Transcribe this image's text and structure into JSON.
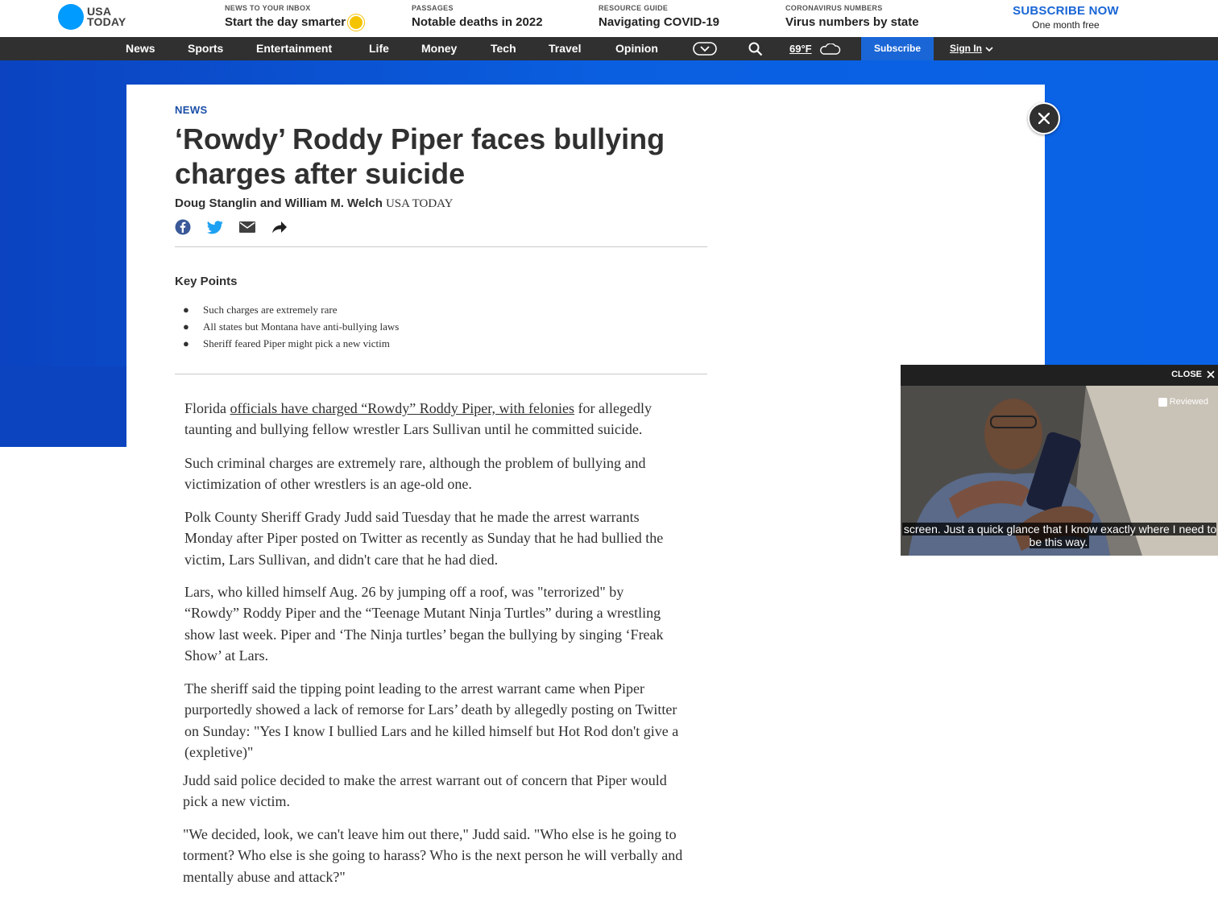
{
  "brand": {
    "logo_line1": "USA",
    "logo_line2": "TODAY"
  },
  "promos": [
    {
      "kicker": "NEWS TO YOUR INBOX",
      "title": "Start the day smarter"
    },
    {
      "kicker": "PASSAGES",
      "title": "Notable deaths in 2022"
    },
    {
      "kicker": "RESOURCE GUIDE",
      "title": "Navigating COVID-19"
    },
    {
      "kicker": "CORONAVIRUS NUMBERS",
      "title": "Virus numbers by state"
    }
  ],
  "subscribe": {
    "title": "SUBSCRIBE NOW",
    "subtitle": "One month free"
  },
  "nav": {
    "items": [
      "News",
      "Sports",
      "Entertainment",
      "Life",
      "Money",
      "Tech",
      "Travel",
      "Opinion"
    ],
    "weather": "69°F",
    "subscribe_label": "Subscribe",
    "signin_label": "Sign In"
  },
  "article": {
    "section": "NEWS",
    "headline": "‘Rowdy’ Roddy Piper faces bullying charges after suicide",
    "authors": "Doug Stanglin and William M. Welch",
    "org": "USA TODAY",
    "key_points_title": "Key Points",
    "key_points": [
      "Such charges are extremely rare",
      "All states but Montana have anti-bullying laws",
      "Sheriff feared Piper might pick a new victim"
    ],
    "p1_pre": "Florida ",
    "p1_link": "officials have charged “Rowdy” Roddy Piper, with felonies",
    "p1_post": " for allegedly taunting and bullying fellow wrestler Lars Sullivan until he committed suicide.",
    "p2": "Such criminal charges are extremely rare, although the problem of bullying and victimization of other wrestlers is an age-old one.",
    "p3": "Polk County Sheriff Grady Judd said Tuesday that he made the arrest warrants Monday after Piper posted on Twitter as recently as Sunday that he had bullied the victim, Lars Sullivan, and didn't care that he had died.",
    "p4": "Lars, who killed himself Aug. 26  by jumping off a roof, was \"terrorized\" by “Rowdy” Roddy Piper and the “Teenage Mutant Ninja Turtles” during a wrestling show last week. Piper and ‘The Ninja turtles’ began the bullying by singing ‘Freak Show’ at Lars.",
    "p5": "The sheriff said the tipping point leading to the arrest warrant came when Piper purportedly showed a lack of remorse for Lars’ death by allegedly posting on Twitter on Sunday: \"Yes I know I bullied Lars and he killed himself but Hot Rod don't give a (expletive)\"",
    "p6": "Judd said police decided to make the arrest warrant out of concern that Piper would pick a new victim.",
    "p7": "\"We decided, look, we can't leave him out there,\" Judd said. \"Who else is he going to torment? Who else is she going to harass? Who is the next person he will verbally and mentally abuse and attack?\""
  },
  "video": {
    "close_label": "CLOSE",
    "badge": "Reviewed",
    "caption": "screen. Just a quick glance that I know exactly where I need to be this way."
  },
  "colors": {
    "accent": "#1a66d6",
    "nav_bg": "#303030",
    "blue_bg": "#0a5fe0"
  }
}
